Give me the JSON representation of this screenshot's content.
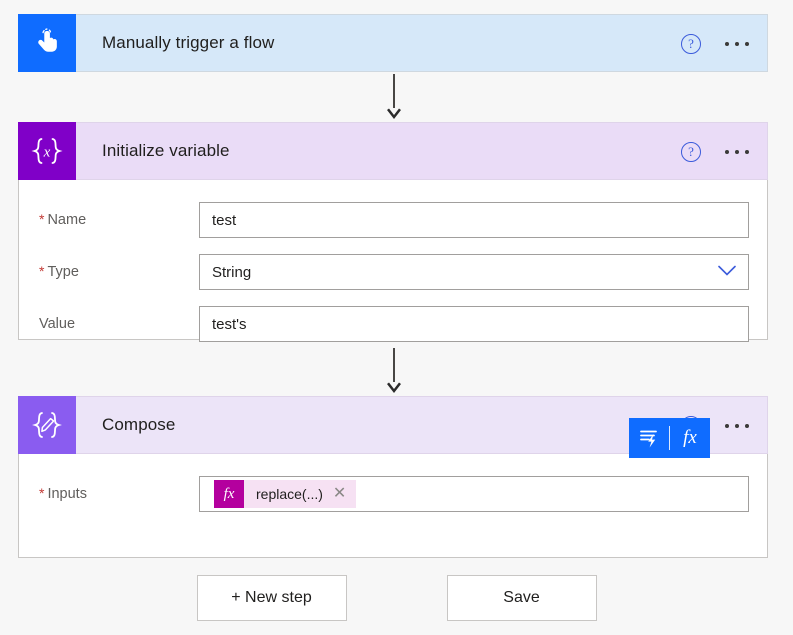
{
  "app": {
    "background": "#f7f7f7"
  },
  "colors": {
    "trigger_icon_bg": "#0f6cff",
    "trigger_header_bg": "#d6e8f9",
    "initvar_icon_bg": "#8000c8",
    "initvar_header_bg": "#eadcf7",
    "compose_icon_bg": "#8a5cf0",
    "compose_header_bg": "#ece4f8",
    "token_fx_bg": "#b4009e",
    "token_bg": "#f6e1f3",
    "toolbar_bg": "#0f6cff",
    "required_asterisk": "#c23934",
    "help_icon": "#3b5bdb"
  },
  "cards": {
    "trigger": {
      "title": "Manually trigger a flow",
      "icon": "pointing-hand-icon",
      "help_label": "?",
      "menu_label": "..."
    },
    "initialize_variable": {
      "title": "Initialize variable",
      "icon": "variable-braces-icon",
      "icon_text": "{x}",
      "help_label": "?",
      "menu_label": "...",
      "fields": [
        {
          "label": "Name",
          "required": true,
          "value": "test",
          "type": "text"
        },
        {
          "label": "Type",
          "required": true,
          "value": "String",
          "type": "dropdown",
          "chevron": "chevron-down-icon"
        },
        {
          "label": "Value",
          "required": false,
          "value": "test's",
          "type": "text"
        }
      ]
    },
    "compose": {
      "title": "Compose",
      "icon": "compose-pencil-braces-icon",
      "icon_text": "{⌀}",
      "help_label": "?",
      "menu_label": "...",
      "toolbar": {
        "dynamic_content_label": "dynamic-content-icon",
        "expression_label": "fx"
      },
      "fields": [
        {
          "label": "Inputs",
          "required": true,
          "token": {
            "fx_label": "fx",
            "text": "replace(...)",
            "close_label": "✕"
          }
        }
      ]
    }
  },
  "footer": {
    "new_step_label": "+ New step",
    "save_label": "Save"
  }
}
